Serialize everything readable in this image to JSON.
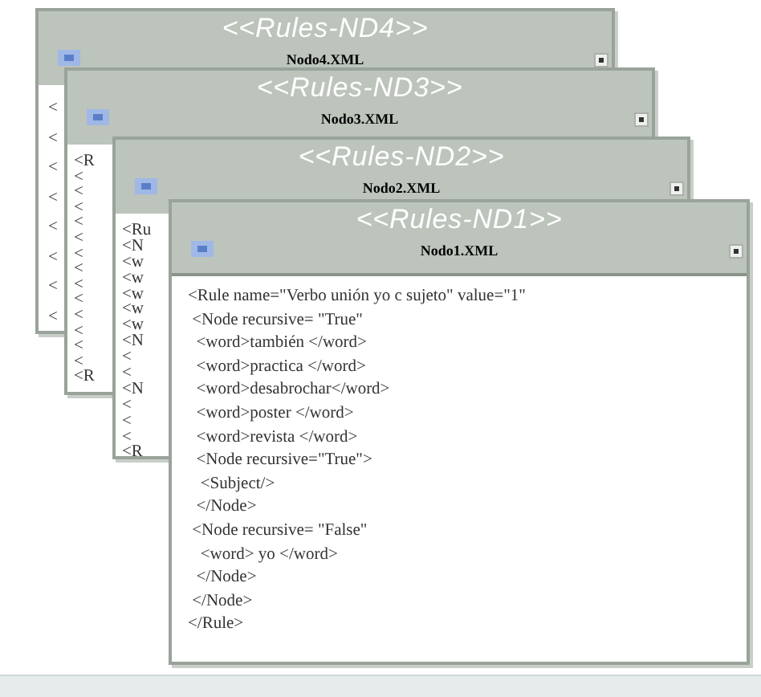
{
  "windows": [
    {
      "heading": "<<Rules-ND4>>",
      "title": "Nodo4.XML",
      "lines": [
        "<",
        "<",
        "<",
        "<",
        "<",
        "<",
        "<",
        "<"
      ]
    },
    {
      "heading": "<<Rules-ND3>>",
      "title": "Nodo3.XML",
      "lines": [
        "<R",
        "<",
        "<",
        "<",
        "<",
        "<",
        "<",
        "<",
        "<",
        "<",
        "<",
        "<",
        "<",
        "<",
        "<R"
      ]
    },
    {
      "heading": "<<Rules-ND2>>",
      "title": "Nodo2.XML",
      "lines": [
        "<Ru",
        "<N",
        "<w",
        "<w",
        "<w",
        "<w",
        "<w",
        "<N",
        "<",
        "<",
        "<N",
        "<",
        "<",
        "<",
        "<R"
      ]
    },
    {
      "heading": "<<Rules-ND1>>",
      "title": "Nodo1.XML",
      "lines": [
        "<Rule name=\"Verbo unión yo c sujeto\" value=\"1\"",
        " <Node recursive= \"True\"",
        "  <word>también </word>",
        "  <word>practica </word>",
        "  <word>desabrochar</word>",
        "  <word>poster </word>",
        "  <word>revista </word>",
        "  <Node recursive=\"True\">",
        "   <Subject/>",
        "  </Node>",
        " <Node recursive= \"False\"",
        "   <word> yo </word>",
        "  </Node>",
        " </Node>",
        "</Rule>"
      ]
    }
  ]
}
